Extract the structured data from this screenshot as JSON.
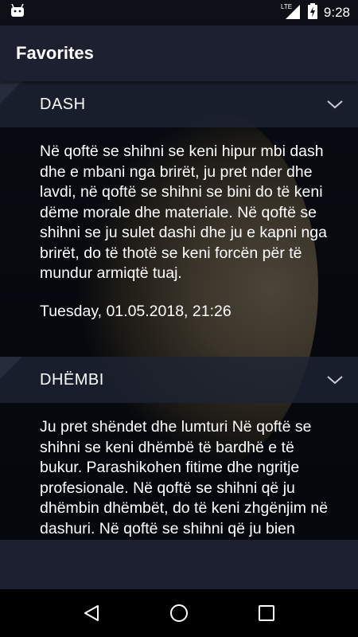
{
  "status_bar": {
    "time": "9:28",
    "network": "LTE",
    "battery_icon": "battery-charging-icon",
    "notification_icon": "android-icon"
  },
  "app_bar": {
    "title": "Favorites"
  },
  "favorites": [
    {
      "title": "DASH",
      "text": "Në qoftë se shihni se keni hipur mbi dash dhe e mbani nga brirët, ju pret nder dhe lavdi, në qoftë se shihni se bini do të keni dëme morale dhe materiale. Në qoftë se shihni se ju sulet dashi dhe ju e kapni nga brirët, do të thotë se keni forcën për të mundur armiqtë tuaj.",
      "date": "Tuesday, 01.05.2018, 21:26"
    },
    {
      "title": "DHËMBI",
      "text": "Ju pret shëndet dhe lumturi Në qoftë se shihni se keni dhëmbë të bardhë e të bukur. Parashikohen fitime dhe ngritje profesionale. Në qoftë se shihni që ju dhëmbin dhëmbët, do të keni zhgënjim në dashuri. Në qoftë se shihni që ju bien dhëmbët, do të vuani nga sëmundje"
    }
  ],
  "colors": {
    "app_bar": "#1c2030",
    "header": "#1a1f2c",
    "text": "#ffffff"
  }
}
